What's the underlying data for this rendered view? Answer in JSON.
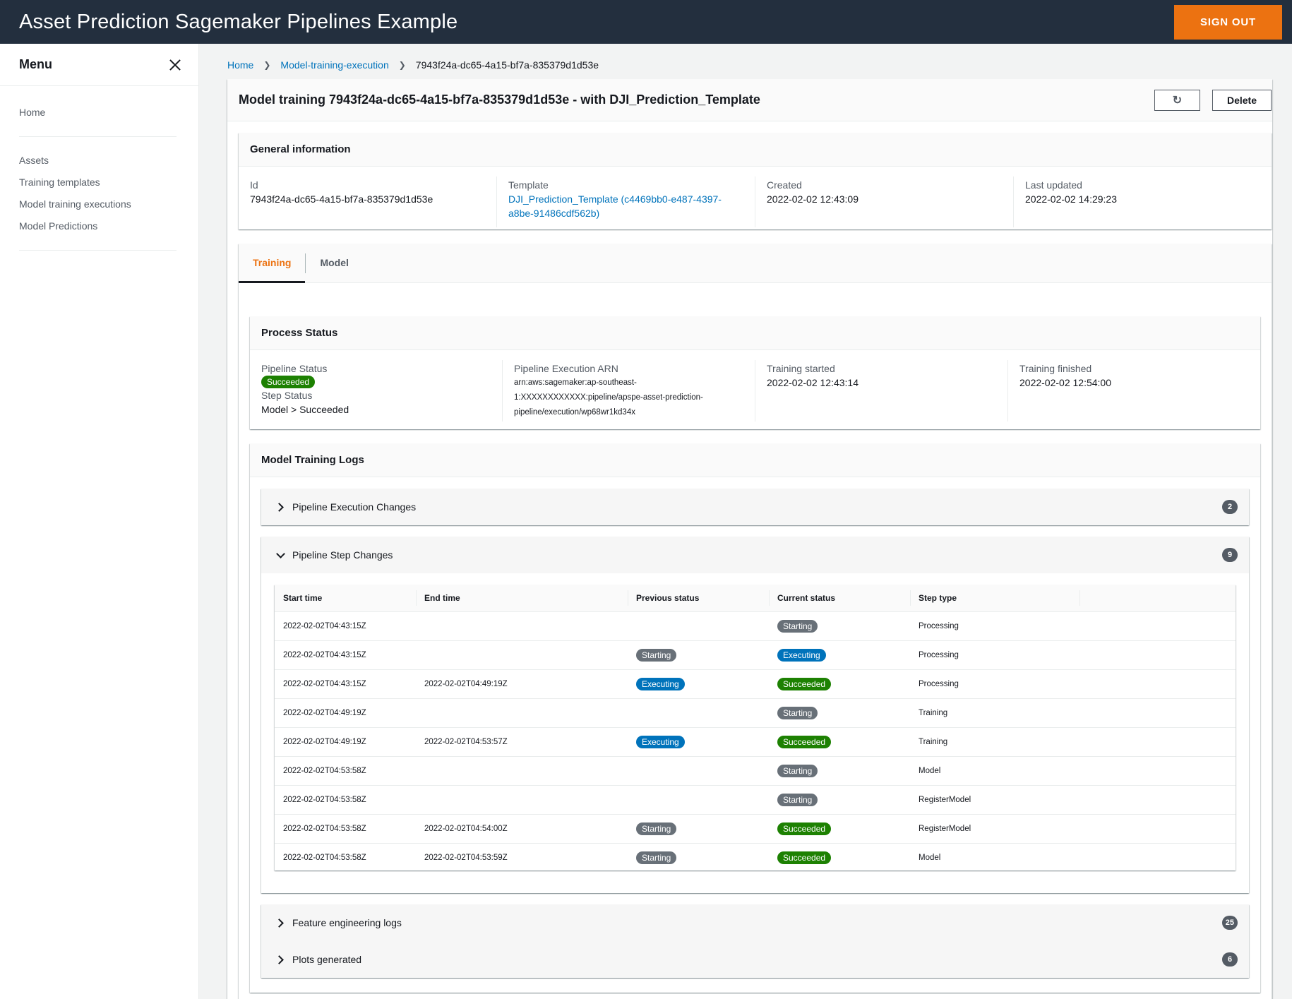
{
  "app": {
    "title": "Asset Prediction Sagemaker Pipelines Example",
    "sign_out_label": "SIGN OUT"
  },
  "sidebar": {
    "title": "Menu",
    "items": [
      {
        "label": "Home"
      },
      {
        "label": "Assets"
      },
      {
        "label": "Training templates"
      },
      {
        "label": "Model training executions"
      },
      {
        "label": "Model Predictions"
      }
    ]
  },
  "breadcrumb": {
    "items": [
      "Home",
      "Model-training-execution",
      "7943f24a-dc65-4a15-bf7a-835379d1d53e"
    ]
  },
  "page": {
    "title": "Model training 7943f24a-dc65-4a15-bf7a-835379d1d53e - with DJI_Prediction_Template",
    "delete_label": "Delete",
    "refresh_icon": "refresh-icon"
  },
  "general": {
    "header": "General information",
    "id_label": "Id",
    "id_value": "7943f24a-dc65-4a15-bf7a-835379d1d53e",
    "template_label": "Template",
    "template_value_line1": "DJI_Prediction_Template (c4469bb0-e487-4397-",
    "template_value_line2": "a8be-91486cdf562b)",
    "created_label": "Created",
    "created_value": "2022-02-02 12:43:09",
    "updated_label": "Last updated",
    "updated_value": "2022-02-02 14:29:23"
  },
  "tabs": [
    {
      "label": "Training",
      "active": true
    },
    {
      "label": "Model",
      "active": false
    }
  ],
  "process": {
    "header": "Process Status",
    "pipeline_status_label": "Pipeline Status",
    "pipeline_status_value": "Succeeded",
    "step_status_label": "Step Status",
    "step_status_value": "Model > Succeeded",
    "arn_label": "Pipeline Execution ARN",
    "arn_line1": "arn:aws:sagemaker:ap-southeast-",
    "arn_line2": "1:XXXXXXXXXXXX:pipeline/apspe-asset-prediction-",
    "arn_line3": "pipeline/execution/wp68wr1kd34x",
    "started_label": "Training started",
    "started_value": "2022-02-02 12:43:14",
    "finished_label": "Training finished",
    "finished_value": "2022-02-02 12:54:00"
  },
  "logs": {
    "header": "Model Training Logs",
    "sections": [
      {
        "title": "Pipeline Execution Changes",
        "count": "2"
      },
      {
        "title": "Pipeline Step Changes",
        "count": "9"
      },
      {
        "title": "Feature engineering logs",
        "count": "25"
      },
      {
        "title": "Plots generated",
        "count": "6"
      }
    ],
    "table": {
      "columns": [
        "Start time",
        "End time",
        "Previous status",
        "Current status",
        "Step type"
      ],
      "rows": [
        {
          "start": "2022-02-02T04:43:15Z",
          "end": "",
          "prev": "",
          "curr": "Starting",
          "type": "Processing"
        },
        {
          "start": "2022-02-02T04:43:15Z",
          "end": "",
          "prev": "Starting",
          "curr": "Executing",
          "type": "Processing"
        },
        {
          "start": "2022-02-02T04:43:15Z",
          "end": "2022-02-02T04:49:19Z",
          "prev": "Executing",
          "curr": "Succeeded",
          "type": "Processing"
        },
        {
          "start": "2022-02-02T04:49:19Z",
          "end": "",
          "prev": "",
          "curr": "Starting",
          "type": "Training"
        },
        {
          "start": "2022-02-02T04:49:19Z",
          "end": "2022-02-02T04:53:57Z",
          "prev": "Executing",
          "curr": "Succeeded",
          "type": "Training"
        },
        {
          "start": "2022-02-02T04:53:58Z",
          "end": "",
          "prev": "",
          "curr": "Starting",
          "type": "Model"
        },
        {
          "start": "2022-02-02T04:53:58Z",
          "end": "",
          "prev": "",
          "curr": "Starting",
          "type": "RegisterModel"
        },
        {
          "start": "2022-02-02T04:53:58Z",
          "end": "2022-02-02T04:54:00Z",
          "prev": "Starting",
          "curr": "Succeeded",
          "type": "RegisterModel"
        },
        {
          "start": "2022-02-02T04:53:58Z",
          "end": "2022-02-02T04:53:59Z",
          "prev": "Starting",
          "curr": "Succeeded",
          "type": "Model"
        }
      ]
    }
  }
}
